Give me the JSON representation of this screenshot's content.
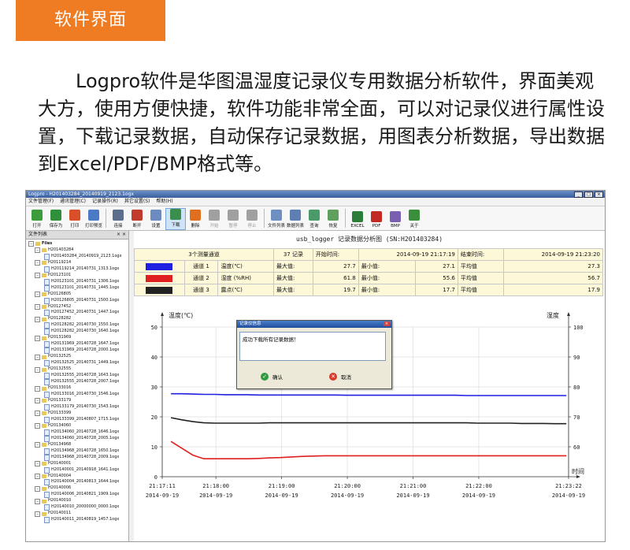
{
  "banner": {
    "title": "软件界面"
  },
  "intro": {
    "text": "Logpro软件是华图温湿度记录仪专用数据分析软件，界面美观大方，使用方便快捷，软件功能非常全面，可以对记录仪进行属性设置，下载记录数据，自动保存记录数据，用图表分析数据，导出数据到Excel/PDF/BMP格式等。"
  },
  "app": {
    "title": "Logpro - H201403284_20140919_2123.1ogx",
    "menu": [
      "文件管理(F)",
      "通讯管理(C)",
      "记录操作(R)",
      "其它设置(S)",
      "帮助(H)"
    ],
    "toolbar": [
      {
        "label": "打开",
        "icon": "open-folder-icon",
        "color": "#3a9c3a"
      },
      {
        "label": "保存为",
        "icon": "save-icon",
        "color": "#2f8f3a"
      },
      {
        "label": "打印",
        "icon": "printer-icon",
        "color": "#d84f2a"
      },
      {
        "label": "打印预览",
        "icon": "print-preview-icon",
        "color": "#4a7bc4"
      },
      {
        "label": "连接",
        "icon": "connect-icon",
        "color": "#5b6e8c"
      },
      {
        "label": "断开",
        "icon": "disconnect-icon",
        "color": "#c03b2b"
      },
      {
        "label": "设置",
        "icon": "settings-icon",
        "color": "#6c8cbf"
      },
      {
        "label": "下载",
        "icon": "download-icon",
        "color": "#3b8f4e"
      },
      {
        "label": "删除",
        "icon": "delete-icon",
        "color": "#e07020"
      },
      {
        "label": "开始",
        "icon": "play-icon",
        "color": "#a0a0a0"
      },
      {
        "label": "暂停",
        "icon": "pause-icon",
        "color": "#a0a0a0"
      },
      {
        "label": "停止",
        "icon": "stop-icon",
        "color": "#a0a0a0"
      },
      {
        "label": "文件列表",
        "icon": "file-list-icon",
        "color": "#6d8fc1"
      },
      {
        "label": "数据列表",
        "icon": "data-list-icon",
        "color": "#5d7fb1"
      },
      {
        "label": "查询",
        "icon": "search-icon",
        "color": "#4b9a6a"
      },
      {
        "label": "恢复",
        "icon": "restore-icon",
        "color": "#5fa05f"
      },
      {
        "label": "EXCEL",
        "icon": "excel-icon",
        "color": "#2c7d3a"
      },
      {
        "label": "PDF",
        "icon": "pdf-icon",
        "color": "#c32a22"
      },
      {
        "label": "BMP",
        "icon": "bmp-icon",
        "color": "#7a5fb0"
      },
      {
        "label": "关于",
        "icon": "about-icon",
        "color": "#3b8f3b"
      }
    ],
    "sidebar": {
      "title": "文件列表",
      "close": "× ×",
      "root": "Files",
      "tree": [
        {
          "level": 0,
          "label": "H201403284"
        },
        {
          "level": 1,
          "label": "H201403284_20140919_2123.1ogx"
        },
        {
          "level": 0,
          "label": "H20119214"
        },
        {
          "level": 1,
          "label": "H20119214_20140731_1313.1ogx"
        },
        {
          "level": 0,
          "label": "H20123101"
        },
        {
          "level": 1,
          "label": "H20123101_20140731_1306.1ogx"
        },
        {
          "level": 1,
          "label": "H20123101_20140731_1445.1ogx"
        },
        {
          "level": 0,
          "label": "H20126805"
        },
        {
          "level": 1,
          "label": "H20126805_20140731_1500.1ogx"
        },
        {
          "level": 0,
          "label": "H20127452"
        },
        {
          "level": 1,
          "label": "H20127452_20140731_1447.1ogx"
        },
        {
          "level": 0,
          "label": "H20128282"
        },
        {
          "level": 1,
          "label": "H20128282_20140730_1550.1ogx"
        },
        {
          "level": 1,
          "label": "H20128282_20140730_1640.1ogx"
        },
        {
          "level": 0,
          "label": "H20131969"
        },
        {
          "level": 1,
          "label": "H20131969_20140728_1647.1ogx"
        },
        {
          "level": 1,
          "label": "H20131969_20140728_2000.1ogx"
        },
        {
          "level": 0,
          "label": "H20132525"
        },
        {
          "level": 1,
          "label": "H20132525_20140731_1449.1ogx"
        },
        {
          "level": 0,
          "label": "H20132555"
        },
        {
          "level": 1,
          "label": "H20132555_20140728_1643.1ogx"
        },
        {
          "level": 1,
          "label": "H20132555_20140728_2007.1ogx"
        },
        {
          "level": 0,
          "label": "H20133016"
        },
        {
          "level": 1,
          "label": "H20133016_20140730_1546.1ogx"
        },
        {
          "level": 0,
          "label": "H20133179"
        },
        {
          "level": 1,
          "label": "H20133179_20140730_1543.1ogx"
        },
        {
          "level": 0,
          "label": "H20133399"
        },
        {
          "level": 1,
          "label": "H20133399_20140807_1715.1ogx"
        },
        {
          "level": 0,
          "label": "H20134060"
        },
        {
          "level": 1,
          "label": "H20134060_20140728_1646.1ogx"
        },
        {
          "level": 1,
          "label": "H20134060_20140728_2005.1ogx"
        },
        {
          "level": 0,
          "label": "H20134968"
        },
        {
          "level": 1,
          "label": "H20134968_20140728_1650.1ogx"
        },
        {
          "level": 1,
          "label": "H20134968_20140728_2009.1ogx"
        },
        {
          "level": 0,
          "label": "H20140001"
        },
        {
          "level": 1,
          "label": "H20140001_20140918_1641.1ogx"
        },
        {
          "level": 0,
          "label": "H20140004"
        },
        {
          "level": 1,
          "label": "H20140004_20140813_1644.1ogx"
        },
        {
          "level": 0,
          "label": "H20140006"
        },
        {
          "level": 1,
          "label": "H20140006_20140821_1909.1ogx"
        },
        {
          "level": 0,
          "label": "H20140010"
        },
        {
          "level": 1,
          "label": "H20140010_20000000_0000.1ogx"
        },
        {
          "level": 0,
          "label": "H20140011"
        },
        {
          "level": 1,
          "label": "H20140011_20140819_1457.1ogx"
        }
      ]
    },
    "report": {
      "title": "usb_logger 记录数据分析图 (SN:H201403284)",
      "summary": {
        "channels": "3个测量通道",
        "records": "37 记录",
        "start_label": "开始时间:",
        "start": "2014-09-19 21:17:19",
        "end_label": "结束时间:",
        "end": "2014-09-19 21:23:20"
      },
      "rows": [
        {
          "color": "#2020e0",
          "channel": "通道 1",
          "name": "温度(℃)",
          "max_label": "最大值:",
          "max": "27.7",
          "min_label": "最小值:",
          "min": "27.1",
          "avg_label": "平均值",
          "avg": "27.3"
        },
        {
          "color": "#e02020",
          "channel": "通道 2",
          "name": "湿度 (%RH)",
          "max_label": "最大值:",
          "max": "61.8",
          "min_label": "最小值:",
          "min": "55.6",
          "avg_label": "平均值",
          "avg": "56.7"
        },
        {
          "color": "#222222",
          "channel": "通道 3",
          "name": "露点(℃)",
          "max_label": "最大值:",
          "max": "19.7",
          "min_label": "最小值:",
          "min": "17.7",
          "avg_label": "平均值",
          "avg": "17.9"
        }
      ]
    },
    "dialog": {
      "title": "记录仪信息",
      "message": "成功下载所有记录数据！",
      "ok": "确认",
      "cancel": "取消"
    }
  },
  "chart_data": {
    "type": "line",
    "ylabel": "温度(℃)",
    "y2label": "湿度",
    "xlabel": "时间",
    "ylim": [
      0,
      50
    ],
    "y2lim": [
      50,
      100
    ],
    "yticks": [
      0,
      10,
      20,
      30,
      40,
      50
    ],
    "y2ticks": [
      60,
      70,
      80,
      90,
      100
    ],
    "x_ticks": [
      {
        "time": "21:17:11",
        "date": "2014-09-19"
      },
      {
        "time": "21:18:00",
        "date": "2014-09-19"
      },
      {
        "time": "21:19:00",
        "date": "2014-09-19"
      },
      {
        "time": "21:20:00",
        "date": "2014-09-19"
      },
      {
        "time": "21:21:00",
        "date": "2014-09-19"
      },
      {
        "time": "21:22:00",
        "date": "2014-09-19"
      },
      {
        "time": "21:23:22",
        "date": "2014-09-19"
      }
    ],
    "x": [
      "21:17:19",
      "21:17:29",
      "21:17:39",
      "21:17:49",
      "21:17:59",
      "21:18:09",
      "21:18:19",
      "21:18:29",
      "21:18:39",
      "21:18:49",
      "21:18:59",
      "21:19:09",
      "21:19:19",
      "21:19:29",
      "21:19:39",
      "21:19:49",
      "21:19:59",
      "21:20:09",
      "21:20:19",
      "21:20:29",
      "21:20:39",
      "21:20:49",
      "21:20:59",
      "21:21:09",
      "21:21:19",
      "21:21:29",
      "21:21:39",
      "21:21:49",
      "21:21:59",
      "21:22:09",
      "21:22:19",
      "21:22:29",
      "21:22:39",
      "21:22:49",
      "21:22:59",
      "21:23:09",
      "21:23:20"
    ],
    "series": [
      {
        "axis": "left",
        "color": "#2020e0",
        "values": [
          27.7,
          27.7,
          27.6,
          27.5,
          27.5,
          27.4,
          27.4,
          27.4,
          27.3,
          27.3,
          27.3,
          27.3,
          27.3,
          27.3,
          27.3,
          27.3,
          27.2,
          27.2,
          27.2,
          27.2,
          27.2,
          27.2,
          27.2,
          27.2,
          27.2,
          27.2,
          27.2,
          27.1,
          27.1,
          27.1,
          27.1,
          27.1,
          27.1,
          27.1,
          27.1,
          27.1,
          27.1
        ]
      },
      {
        "axis": "right",
        "color": "#e02020",
        "values": [
          61.8,
          59.5,
          57.2,
          56.0,
          56.0,
          56.0,
          56.0,
          56.0,
          56.1,
          56.3,
          56.4,
          56.6,
          56.8,
          56.9,
          57.0,
          57.0,
          57.0,
          57.0,
          57.0,
          57.0,
          57.0,
          57.0,
          57.0,
          57.0,
          57.0,
          57.0,
          57.0,
          57.0,
          57.0,
          57.0,
          57.0,
          57.0,
          57.0,
          57.0,
          57.0,
          57.0,
          57.0
        ]
      },
      {
        "axis": "left",
        "color": "#222222",
        "values": [
          19.7,
          19.0,
          18.4,
          18.0,
          17.9,
          17.9,
          17.9,
          17.9,
          17.9,
          18.0,
          18.0,
          18.0,
          18.0,
          18.0,
          18.0,
          18.0,
          18.0,
          18.0,
          18.0,
          18.0,
          18.0,
          18.0,
          18.0,
          18.0,
          18.0,
          18.0,
          18.0,
          18.0,
          17.9,
          17.9,
          17.9,
          17.9,
          17.8,
          17.8,
          17.8,
          17.7,
          17.7
        ]
      }
    ]
  }
}
